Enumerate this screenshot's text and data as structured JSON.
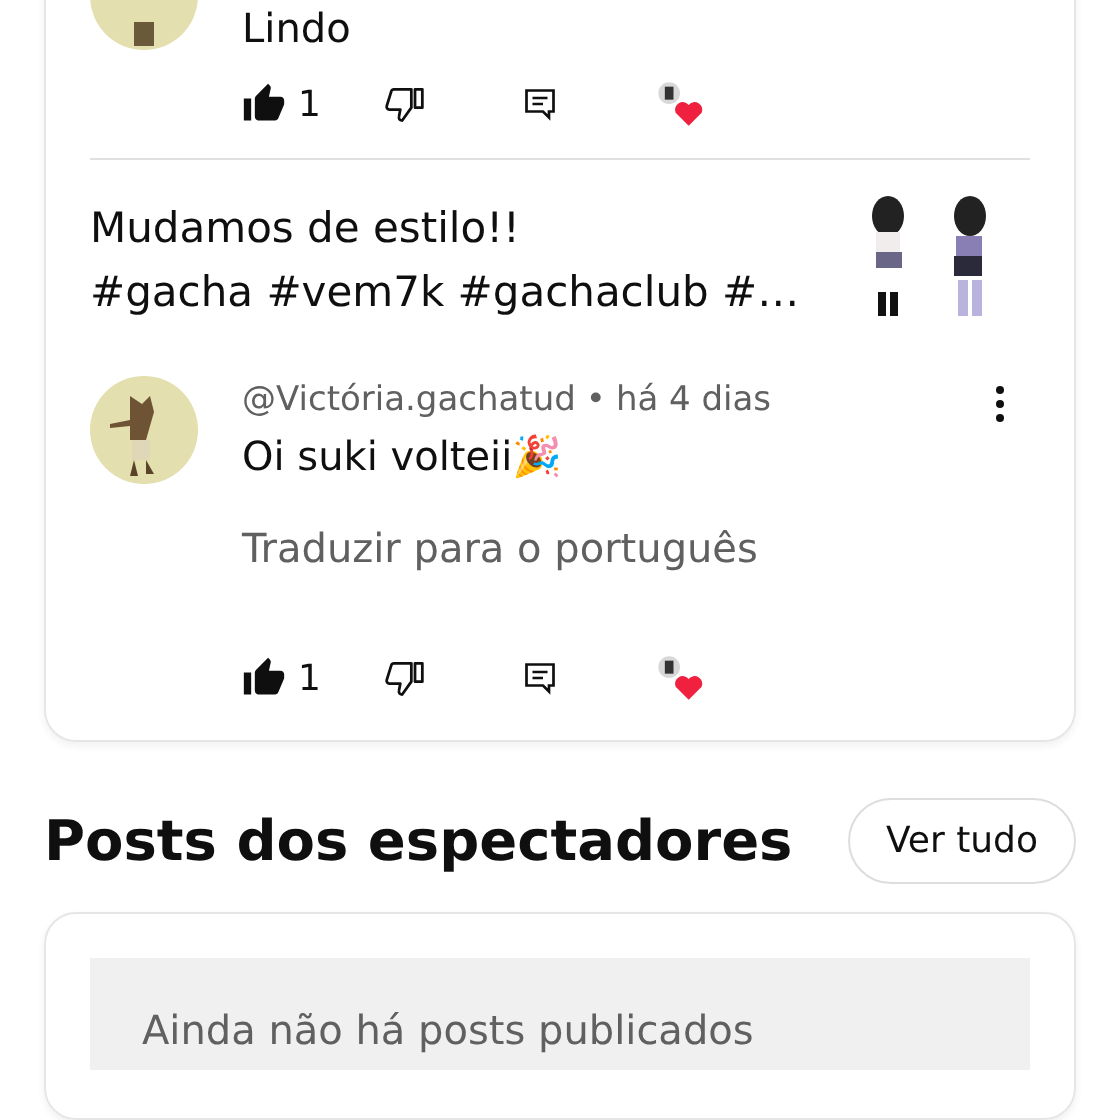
{
  "previous_comment": {
    "text": "Lindo",
    "actions": {
      "liked": true,
      "like_count": "1",
      "creator_heart": true
    }
  },
  "post": {
    "title": "Mudamos de estilo!!",
    "hashtags": "#gacha #vem7k #gachaclub #…"
  },
  "comment": {
    "author": "@Victória.gachatud",
    "separator": "•",
    "time": "há 4 dias",
    "text": "Oi suki volteii🎉",
    "translate": "Traduzir para o português",
    "actions": {
      "liked": true,
      "like_count": "1",
      "creator_heart": true
    }
  },
  "viewer_posts": {
    "title": "Posts dos espectadores",
    "button": "Ver tudo",
    "empty_message": "Ainda não há posts publicados"
  }
}
